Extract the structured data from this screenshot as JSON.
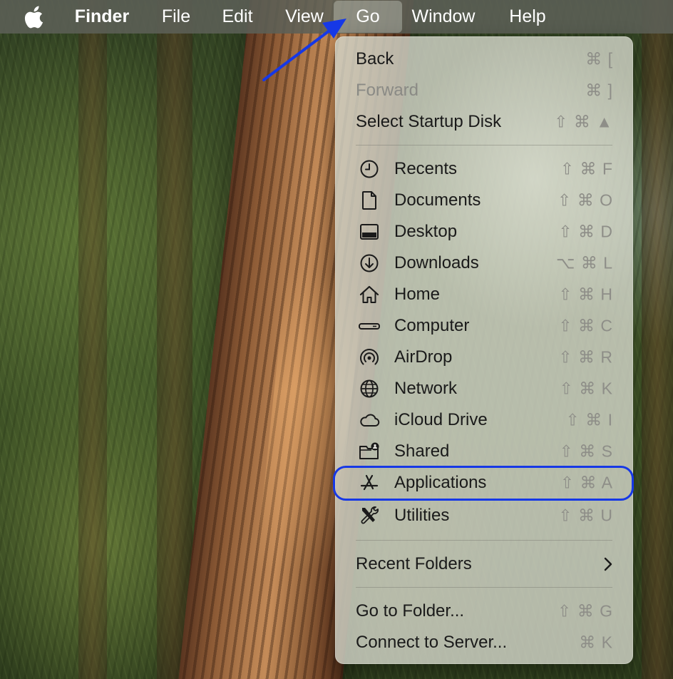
{
  "menubar": {
    "apple_icon": "apple-icon",
    "items": [
      {
        "label": "Finder",
        "bold": true
      },
      {
        "label": "File"
      },
      {
        "label": "Edit"
      },
      {
        "label": "View"
      },
      {
        "label": "Go",
        "active": true
      },
      {
        "label": "Window"
      },
      {
        "label": "Help"
      }
    ]
  },
  "go_menu": {
    "nav_items": [
      {
        "label": "Back",
        "shortcut": "⌘ [",
        "enabled": true
      },
      {
        "label": "Forward",
        "shortcut": "⌘ ]",
        "enabled": false
      },
      {
        "label": "Select Startup Disk",
        "shortcut": "⇧ ⌘ ▲",
        "enabled": true
      }
    ],
    "places": [
      {
        "label": "Recents",
        "shortcut": "⇧ ⌘ F",
        "icon": "clock-icon"
      },
      {
        "label": "Documents",
        "shortcut": "⇧ ⌘ O",
        "icon": "document-icon"
      },
      {
        "label": "Desktop",
        "shortcut": "⇧ ⌘ D",
        "icon": "desktop-icon"
      },
      {
        "label": "Downloads",
        "shortcut": "⌥ ⌘ L",
        "icon": "download-icon"
      },
      {
        "label": "Home",
        "shortcut": "⇧ ⌘ H",
        "icon": "home-icon"
      },
      {
        "label": "Computer",
        "shortcut": "⇧ ⌘ C",
        "icon": "computer-icon"
      },
      {
        "label": "AirDrop",
        "shortcut": "⇧ ⌘ R",
        "icon": "airdrop-icon"
      },
      {
        "label": "Network",
        "shortcut": "⇧ ⌘ K",
        "icon": "globe-icon"
      },
      {
        "label": "iCloud Drive",
        "shortcut": "⇧ ⌘ I",
        "icon": "cloud-icon"
      },
      {
        "label": "Shared",
        "shortcut": "⇧ ⌘ S",
        "icon": "shared-folder-icon"
      },
      {
        "label": "Applications",
        "shortcut": "⇧ ⌘ A",
        "icon": "applications-icon",
        "highlighted": true
      },
      {
        "label": "Utilities",
        "shortcut": "⇧ ⌘ U",
        "icon": "utilities-icon"
      }
    ],
    "recent_folders": {
      "label": "Recent Folders",
      "icon": "chevron-right-icon"
    },
    "bottom_items": [
      {
        "label": "Go to Folder...",
        "shortcut": "⇧ ⌘ G"
      },
      {
        "label": "Connect to Server...",
        "shortcut": "⌘ K"
      }
    ]
  },
  "annotations": {
    "arrow_color": "#1638e6",
    "ring_color": "#1638e6"
  }
}
